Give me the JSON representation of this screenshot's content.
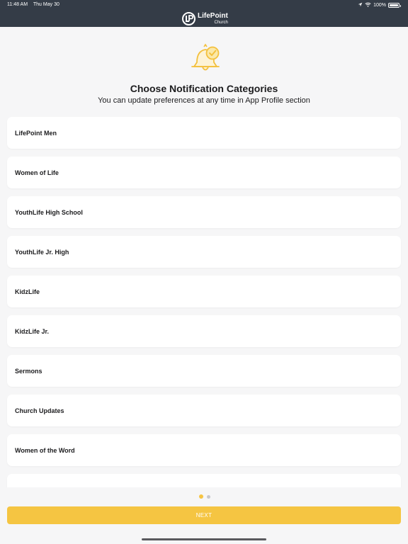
{
  "status_bar": {
    "time": "11:48 AM",
    "date": "Thu May 30",
    "battery": "100%"
  },
  "header": {
    "logo_title": "LifePoint",
    "logo_subtitle": "Church"
  },
  "main": {
    "title": "Choose Notification Categories",
    "subtitle": "You can update preferences at any time in App Profile section",
    "categories": [
      "LifePoint Men",
      "Women of Life",
      "YouthLife High School",
      "YouthLife Jr. High",
      "KidzLife",
      "KidzLife Jr.",
      "Sermons",
      "Church Updates",
      "Women of the Word",
      ""
    ]
  },
  "pagination": {
    "current_page": 1,
    "total_pages": 2
  },
  "footer": {
    "next_label": "NEXT"
  },
  "colors": {
    "header_bg": "#343c47",
    "accent": "#f5c542",
    "page_bg": "#f6f6f7"
  },
  "icons": [
    "location-arrow-icon",
    "wifi-icon",
    "battery-icon",
    "bell-check-icon",
    "lifepoint-logo"
  ]
}
